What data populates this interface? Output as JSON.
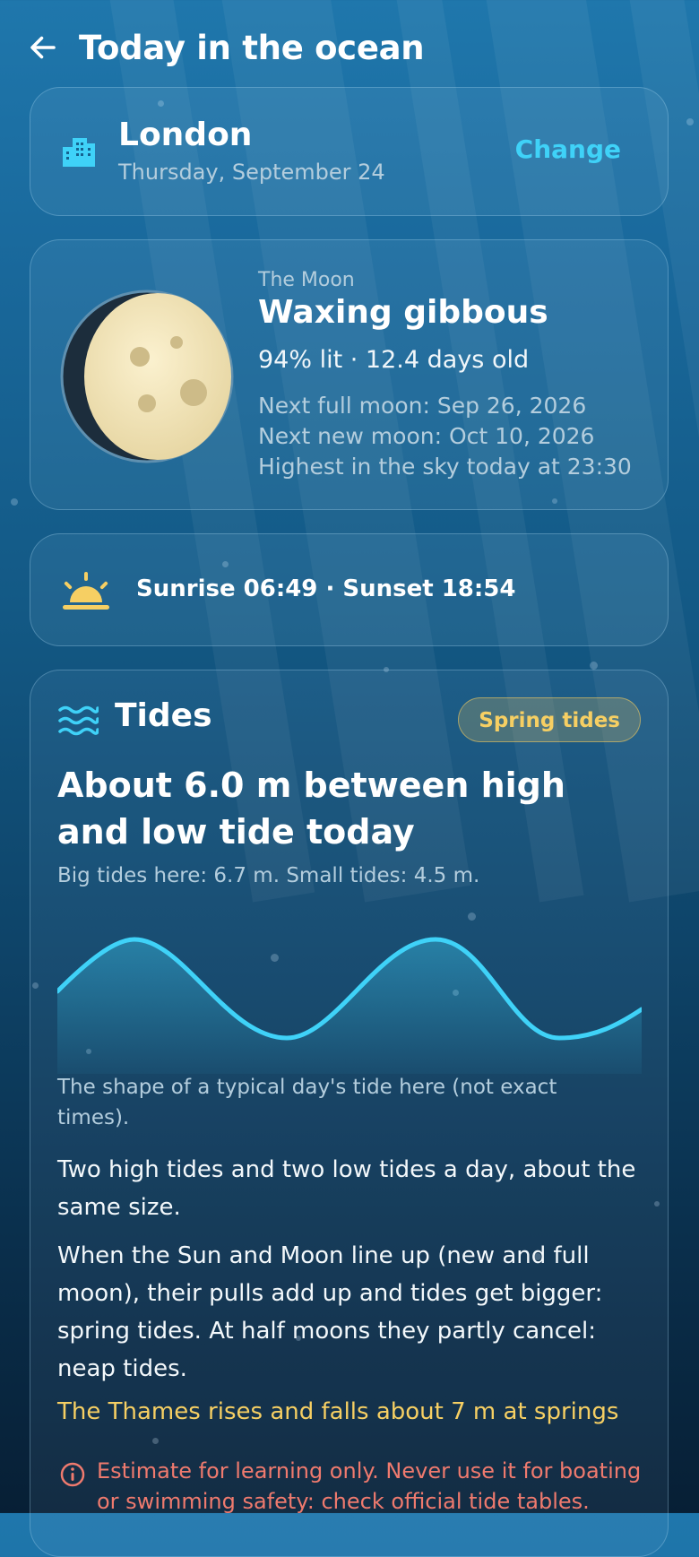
{
  "header": {
    "title": "Today in the ocean",
    "back_icon": "arrow-left-icon"
  },
  "location": {
    "icon": "city-icon",
    "city": "London",
    "date": "Thursday, September 24",
    "change_label": "Change"
  },
  "moon": {
    "label": "The Moon",
    "phase": "Waxing gibbous",
    "lit_age": "94% lit · 12.4 days old",
    "illumination_percent": 94,
    "next_full": "Next full moon: Sep 26, 2026",
    "next_new": "Next new moon: Oct 10, 2026",
    "highest": "Highest in the sky today at 23:30"
  },
  "sun": {
    "icon": "sunrise-icon",
    "text": "Sunrise 06:49 · Sunset 18:54"
  },
  "tides": {
    "icon": "waves-icon",
    "title": "Tides",
    "badge": "Spring tides",
    "headline": "About 6.0 m between high and low tide today",
    "subline": "Big tides here: 6.7 m. Small tides: 4.5 m.",
    "chart_caption": "The shape of a typical day's tide here (not exact times).",
    "para1": "Two high tides and two low tides a day, about the same size.",
    "para2": "When the Sun and Moon line up (new and full moon), their pulls add up and tides get bigger: spring tides. At half moons they partly cancel: neap tides.",
    "highlight": "The Thames rises and falls about 7 m at springs",
    "warning_icon": "info-icon",
    "warning": "Estimate for learning only. Never use it for boating or swimming safety: check official tide tables."
  },
  "colors": {
    "accent": "#3fd2f8",
    "gold": "#f6cf63",
    "warning": "#ef7a6e",
    "moon": "#f2e5b8"
  }
}
